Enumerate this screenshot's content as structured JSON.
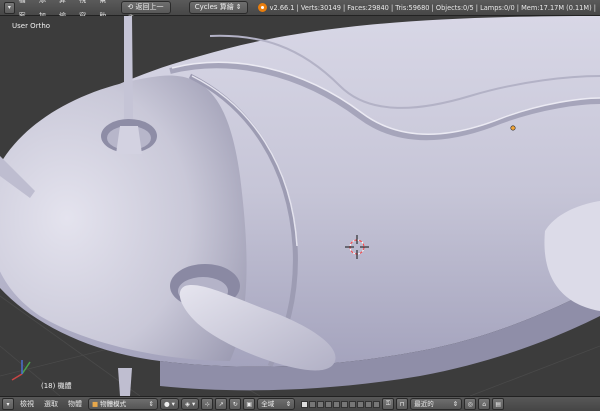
{
  "top_menu": {
    "file": "檔案",
    "add": "添加",
    "render": "算繪",
    "window": "視窗",
    "help": "幫助"
  },
  "undo_button": "返回上一步",
  "render_engine": "Cycles 算繪",
  "stats": "v2.66.1 | Verts:30149 | Faces:29840 | Tris:59680 | Objects:0/5 | Lamps:0/0 | Mem:17.17M (0.11M) |",
  "viewport": {
    "view_label": "User Ortho",
    "object_label": "(18) 機體"
  },
  "bottom_menu": {
    "view": "檢視",
    "select": "選取",
    "object": "物體"
  },
  "mode": "物體模式",
  "orientation": "全域",
  "snap": "最近的",
  "icons": [
    "blender-logo",
    "mode-icon",
    "shading-sphere-icon",
    "pivot-icon",
    "manipulator-icon",
    "translate-icon",
    "rotate-icon",
    "scale-icon",
    "orientation-icon",
    "layers-icon",
    "lock-icon",
    "snap-icon",
    "render-icon"
  ]
}
